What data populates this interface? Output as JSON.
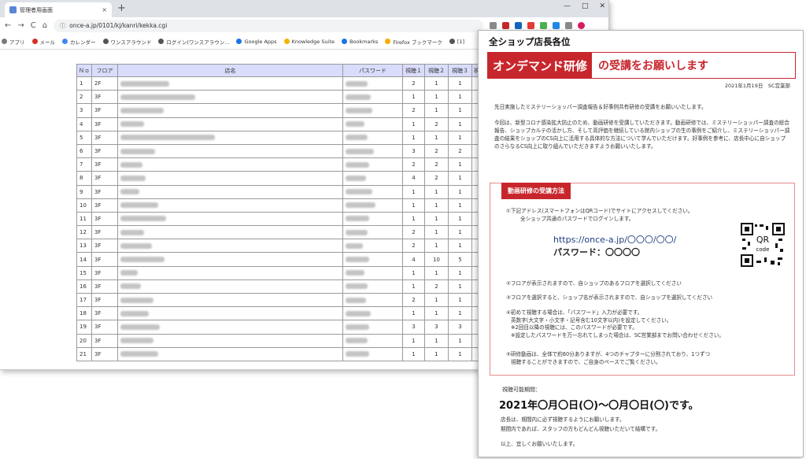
{
  "browser": {
    "tab_title": "管理者用画面",
    "tab_close": "×",
    "new_tab": "+",
    "window_controls": [
      "—",
      "□",
      "✕"
    ],
    "nav": {
      "back": "←",
      "forward": "→",
      "reload": "C",
      "home": "⌂"
    },
    "url_lock": "ⓘ",
    "url": "once-a.jp/0101/kj/kanri/kekka.cgi",
    "bookmarks": [
      {
        "label": "アプリ",
        "color": "#7a7a7a"
      },
      {
        "label": "メール",
        "color": "#d93025"
      },
      {
        "label": "カレンダー",
        "color": "#4285f4"
      },
      {
        "label": "ワンスアラウンド",
        "color": "#555555"
      },
      {
        "label": "ログイン(ワンスアラウン...",
        "color": "#555555"
      },
      {
        "label": "Google Apps",
        "color": "#1a73e8"
      },
      {
        "label": "Knowledge Suite",
        "color": "#f4b400"
      },
      {
        "label": "Bookmarks",
        "color": "#1a73e8"
      },
      {
        "label": "Firefox ブックマーク",
        "color": "#f9ab00"
      },
      {
        "label": "[1]",
        "color": "#555555"
      }
    ],
    "toolbar_icon_colors": [
      "#8a8a8a",
      "#c62828",
      "#1565c0",
      "#e53935",
      "#4caf50",
      "#1e88e5",
      "#8a8a8a",
      "#d81b60"
    ]
  },
  "table": {
    "headers": [
      "Ｎｏ",
      "フロア",
      "店名",
      "パスワード",
      "視聴１",
      "視聴２",
      "視聴３",
      "視"
    ],
    "rows": [
      {
        "no": "1",
        "floor": "2F",
        "v1": "2",
        "v2": "1",
        "v3": "1"
      },
      {
        "no": "2",
        "floor": "3F",
        "v1": "1",
        "v2": "1",
        "v3": "1"
      },
      {
        "no": "3",
        "floor": "3F",
        "v1": "2",
        "v2": "1",
        "v3": "1"
      },
      {
        "no": "4",
        "floor": "3F",
        "v1": "1",
        "v2": "2",
        "v3": "1"
      },
      {
        "no": "5",
        "floor": "3F",
        "v1": "1",
        "v2": "1",
        "v3": "1"
      },
      {
        "no": "6",
        "floor": "3F",
        "v1": "3",
        "v2": "2",
        "v3": "2"
      },
      {
        "no": "7",
        "floor": "3F",
        "v1": "2",
        "v2": "2",
        "v3": "1"
      },
      {
        "no": "8",
        "floor": "3F",
        "v1": "4",
        "v2": "2",
        "v3": "1"
      },
      {
        "no": "9",
        "floor": "3F",
        "v1": "1",
        "v2": "1",
        "v3": "1"
      },
      {
        "no": "10",
        "floor": "3F",
        "v1": "1",
        "v2": "1",
        "v3": "1"
      },
      {
        "no": "11",
        "floor": "3F",
        "v1": "1",
        "v2": "1",
        "v3": "1"
      },
      {
        "no": "12",
        "floor": "3F",
        "v1": "2",
        "v2": "1",
        "v3": "1"
      },
      {
        "no": "13",
        "floor": "3F",
        "v1": "2",
        "v2": "1",
        "v3": "1"
      },
      {
        "no": "14",
        "floor": "3F",
        "v1": "4",
        "v2": "10",
        "v3": "5"
      },
      {
        "no": "15",
        "floor": "3F",
        "v1": "1",
        "v2": "1",
        "v3": "1"
      },
      {
        "no": "16",
        "floor": "3F",
        "v1": "1",
        "v2": "2",
        "v3": "1"
      },
      {
        "no": "17",
        "floor": "3F",
        "v1": "2",
        "v2": "1",
        "v3": "1"
      },
      {
        "no": "18",
        "floor": "3F",
        "v1": "1",
        "v2": "1",
        "v3": "1"
      },
      {
        "no": "19",
        "floor": "3F",
        "v1": "3",
        "v2": "3",
        "v3": "3"
      },
      {
        "no": "20",
        "floor": "3F",
        "v1": "1",
        "v2": "1",
        "v3": "1"
      },
      {
        "no": "21",
        "floor": "3F",
        "v1": "1",
        "v2": "1",
        "v3": "1"
      }
    ]
  },
  "notice": {
    "heading": "全ショップ店長各位",
    "banner_highlight": "オンデマンド研修",
    "banner_rest": "の受講をお願いします",
    "date": "2021年1月19日　SC営業部",
    "intro1": "先日実施したミステリーショッパー調査報告＆好事例共有研修の受講をお願いいたします。",
    "intro2": "今回は、新型コロナ感染拡大防止のため、動画研修を受講していただきます。動画研修では、ミステリーショッパー調査の総合報告、ショップカルテの活かし方、そして高評価を継続している館内ショップの生の事例をご紹介し、ミステリーショッパー調査の結果をショップのCS向上に活用する具体的な方法について学んでいただけます。好事例を参考に、店長中心に自ショップのさらなるCS向上に取り組んでいただきますようお願いいたします。",
    "section_title": "動画研修の受講方法",
    "step1a": "①下記アドレス(スマートフォンはQRコード)でサイトにアクセスしてください。",
    "step1b": "全ショップ共通のパスワードでログインします。",
    "url": "https://once-a.jp/〇〇〇/〇〇/",
    "password": "パスワード：〇〇〇〇",
    "qr_text": "QR\ncode",
    "step2": "②フロアが表示されますので、自ショップのあるフロアを選択してください",
    "step3": "③フロアを選択すると、ショップ名が表示されますので、自ショップを選択してください",
    "step4a": "④初めて視聴する場合は、「パスワード」入力が必要です。",
    "step4b": "英数字(大文字・小文字・記号含む10文字以内)を設定してください。",
    "step4c": "※2回目以降の視聴には、このパスワードが必要です。",
    "step4d": "※設定したパスワードを万一忘れてしまった場合は、SC営業部までお問い合わせください。",
    "step5a": "⑤研修動画は、全体で約60分ありますが、4つのチャプターに分割されており、1つずつ",
    "step5b": "視聴することができますので、ご自身のペースでご覧ください。",
    "period_label": "視聴可能期間：",
    "period": "2021年〇月〇日(〇)～〇月〇日(〇)です。",
    "footer1": "店長は、期間内に必ず視聴するようにお願いします。",
    "footer2": "期間内であれば、スタッフの方もどんどん視聴いただいて結構です。",
    "footer3": "以上、宜しくお願いいたします。"
  }
}
